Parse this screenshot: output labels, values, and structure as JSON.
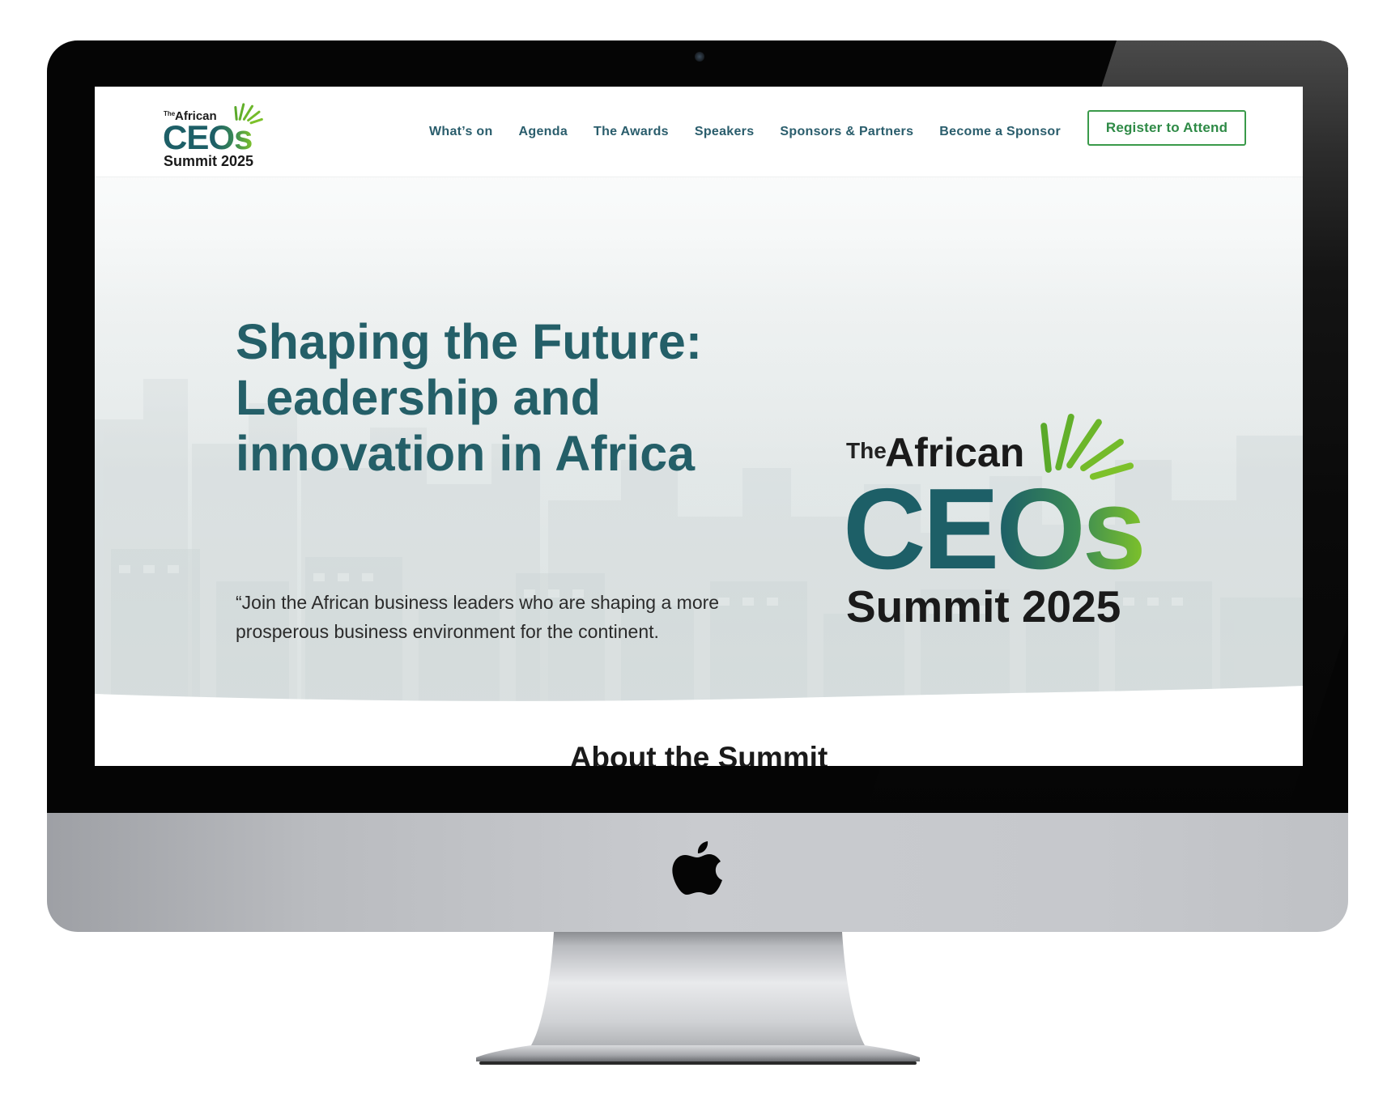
{
  "site": {
    "logo": {
      "the": "The",
      "african": "African",
      "ceos": "CEOs",
      "summit": "Summit 2025"
    },
    "nav": {
      "items": [
        {
          "label": "What’s on"
        },
        {
          "label": "Agenda"
        },
        {
          "label": "The Awards"
        },
        {
          "label": "Speakers"
        },
        {
          "label": "Sponsors & Partners"
        },
        {
          "label": "Become a Sponsor"
        }
      ],
      "cta_label": "Register to Attend"
    },
    "hero": {
      "title_lines": [
        "Shaping the Future:",
        "Leadership and",
        "innovation in Africa"
      ],
      "subtitle_lines": [
        "“Join the African business leaders who are shaping a more",
        "prosperous business environment for the continent."
      ]
    },
    "about": {
      "title": "About the Summit"
    }
  },
  "colors": {
    "brand_teal": "#1d5f67",
    "brand_green": "#7dc12a",
    "nav_text": "#2a5d6c",
    "cta_border": "#3a9a4a"
  },
  "icons": {
    "device_logo": "apple-icon",
    "camera": "webcam-icon"
  }
}
